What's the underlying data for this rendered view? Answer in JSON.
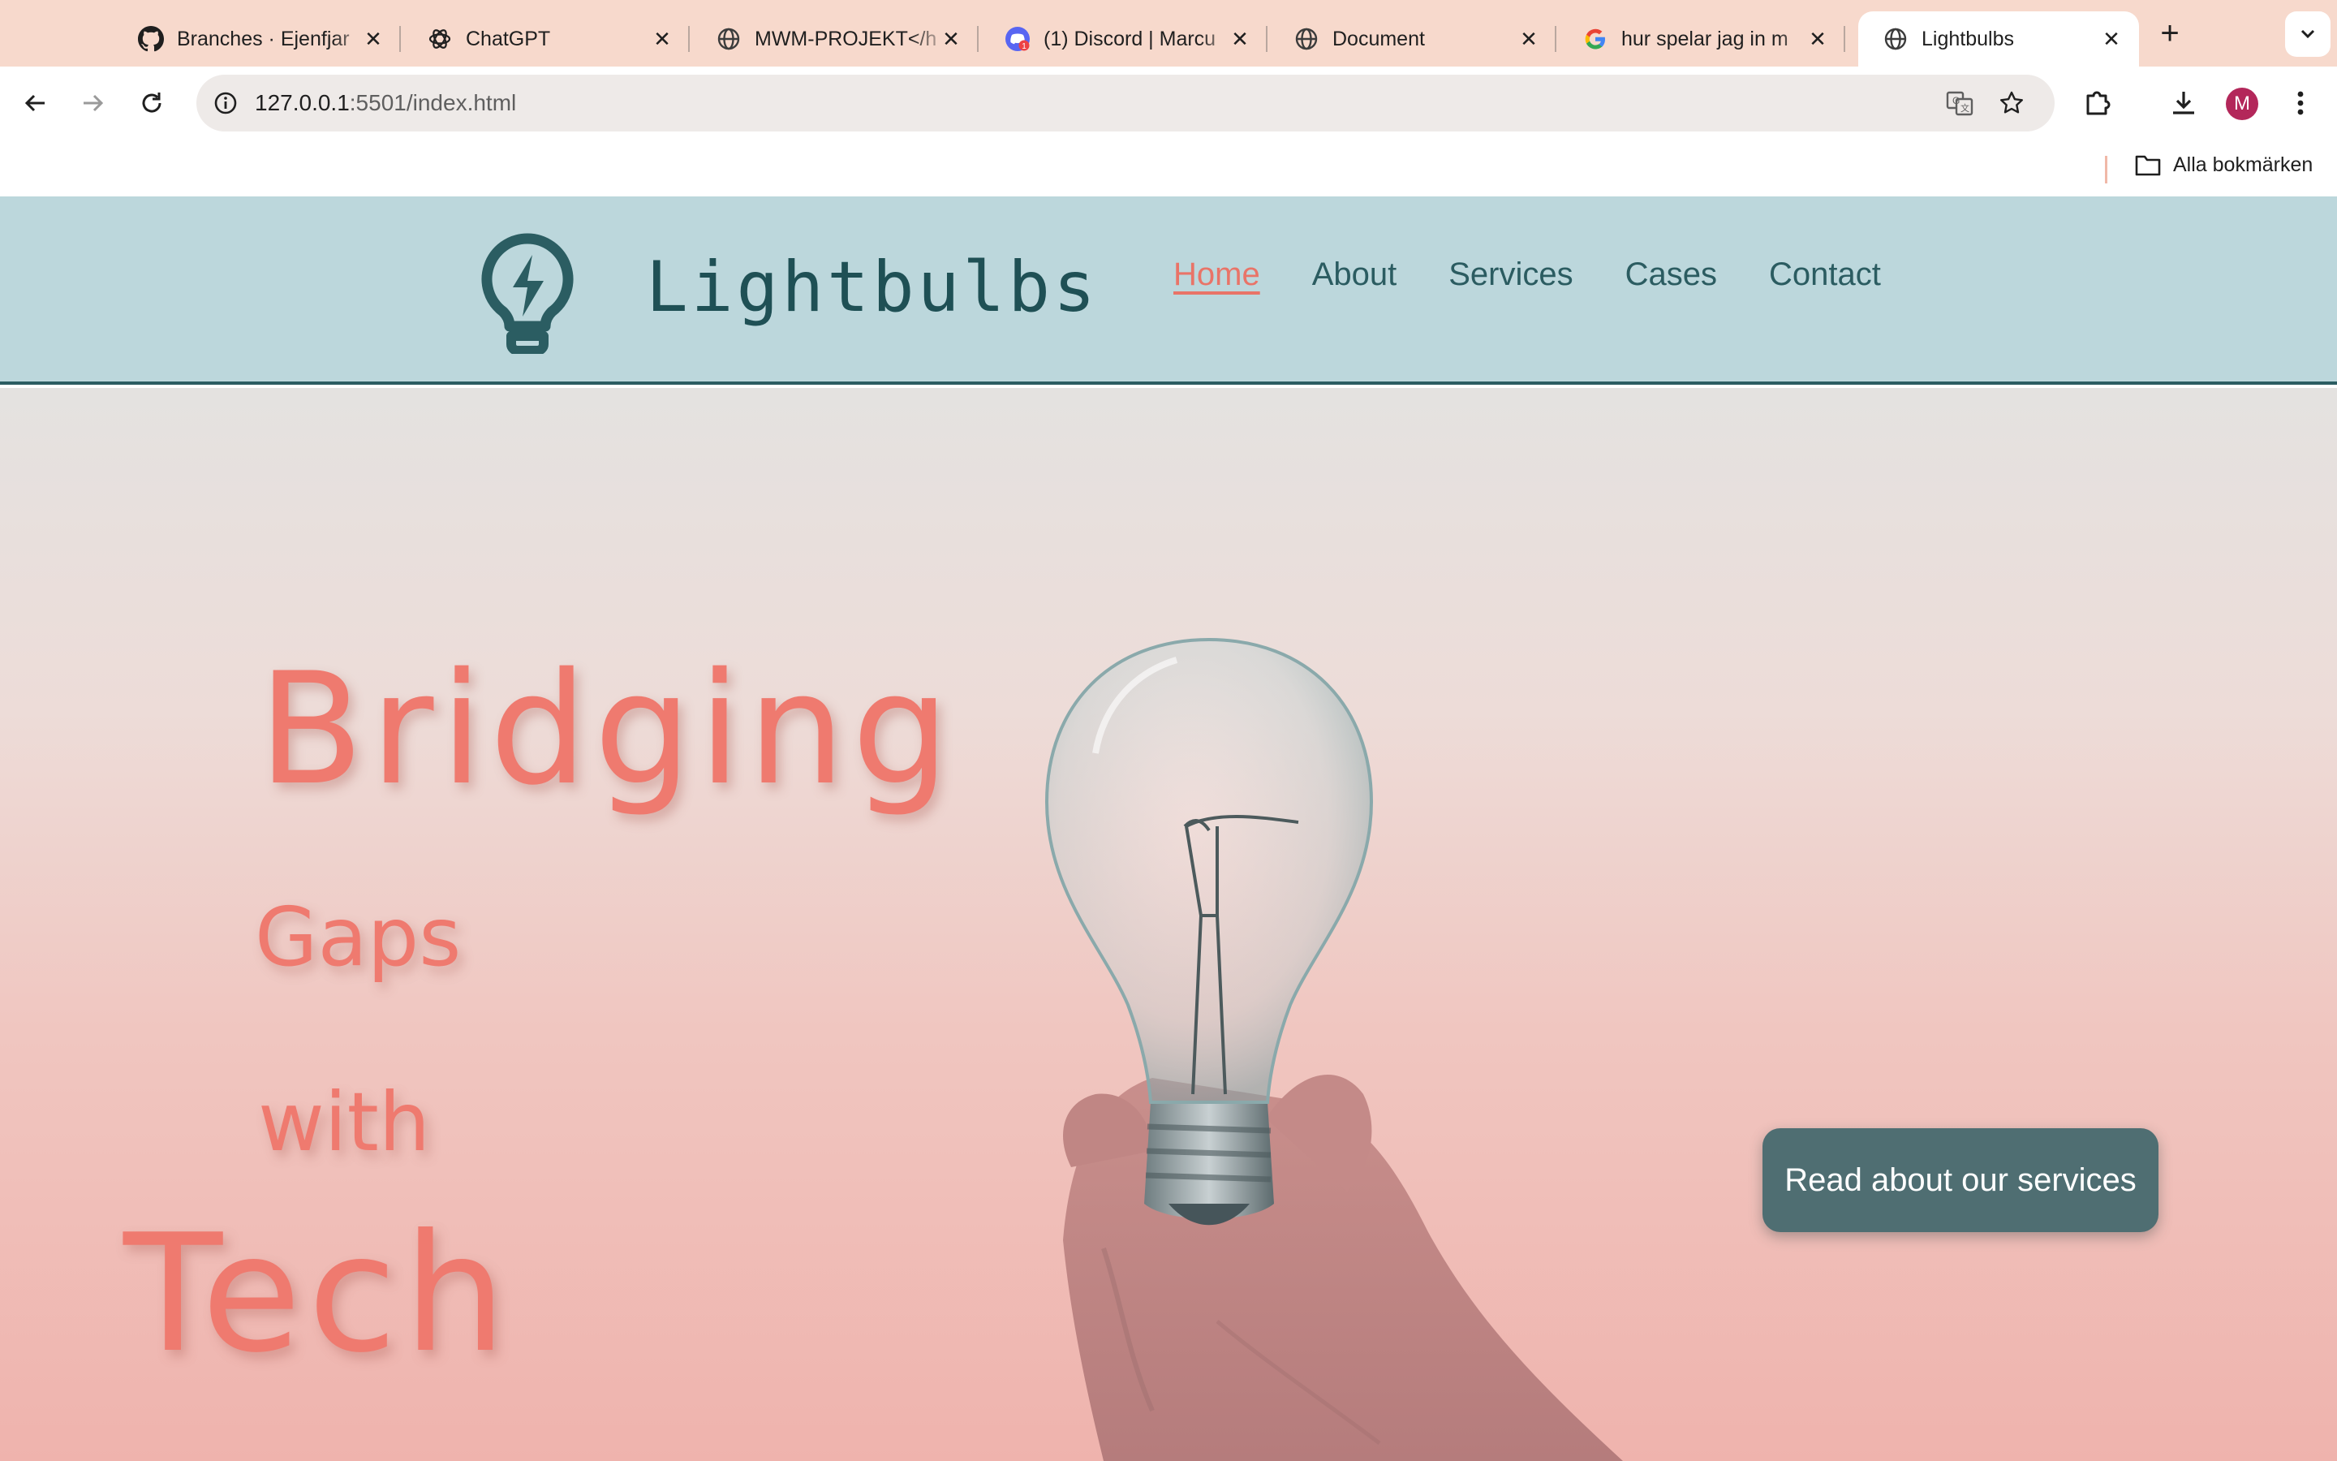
{
  "browser": {
    "tabs": [
      {
        "title": "Branches · Ejenfjar",
        "icon": "github-icon",
        "active": false
      },
      {
        "title": "ChatGPT",
        "icon": "chatgpt-icon",
        "active": false
      },
      {
        "title": "MWM-PROJEKT</h",
        "icon": "globe-icon",
        "active": false
      },
      {
        "title": "(1) Discord | Marcu",
        "icon": "discord-icon",
        "active": false
      },
      {
        "title": "Document",
        "icon": "globe-icon",
        "active": false
      },
      {
        "title": "hur spelar jag in m",
        "icon": "google-icon",
        "active": false
      },
      {
        "title": "Lightbulbs",
        "icon": "globe-icon",
        "active": true
      }
    ],
    "new_tab_label": "+",
    "close_glyph": "✕",
    "address": {
      "host": "127.0.0.1",
      "rest": ":5501/index.html"
    },
    "profile_initial": "M",
    "bookmarks_folder": "Alla bokmärken"
  },
  "site": {
    "brand": "Lightbulbs",
    "nav": [
      {
        "label": "Home",
        "active": true
      },
      {
        "label": "About",
        "active": false
      },
      {
        "label": "Services",
        "active": false
      },
      {
        "label": "Cases",
        "active": false
      },
      {
        "label": "Contact",
        "active": false
      }
    ],
    "hero": {
      "words": [
        "Bridging",
        "Gaps",
        "with",
        "Tech"
      ],
      "cta_label": "Read about our services"
    }
  },
  "colors": {
    "tabstrip": "#f7d9cc",
    "header_bg": "#bcd7dc",
    "brand_text": "#1f5055",
    "nav_active": "#e97468",
    "hero_text": "#ef7a6f",
    "cta_bg": "#4f6e72",
    "avatar": "#b3275a"
  }
}
